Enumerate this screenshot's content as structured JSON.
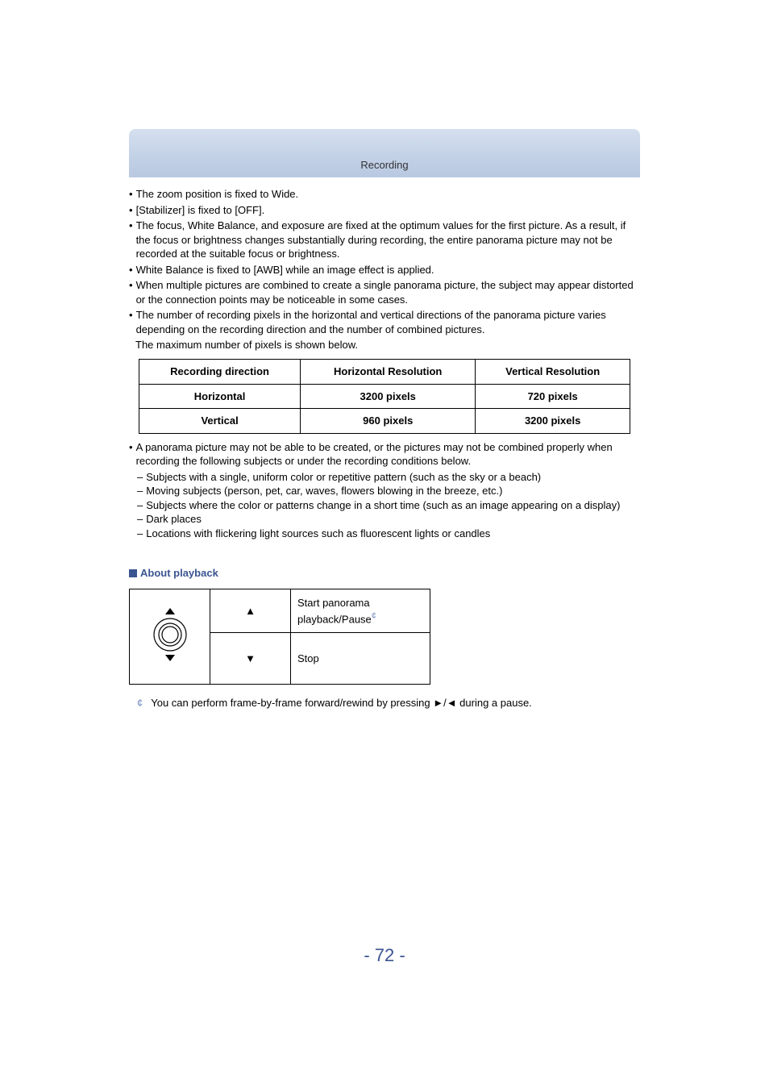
{
  "header": {
    "title": "Recording"
  },
  "bullets": [
    "The zoom position is fixed to Wide.",
    "[Stabilizer] is fixed to [OFF].",
    "The focus, White Balance, and exposure are fixed at the optimum values for the first picture. As a result, if the focus or brightness changes substantially during recording, the entire panorama picture may not be recorded at the suitable focus or brightness.",
    "White Balance is fixed to [AWB] while an image effect is applied.",
    "When multiple pictures are combined to create a single panorama picture, the subject may appear distorted or the connection points may be noticeable in some cases."
  ],
  "pixels_intro": "The number of recording pixels in the horizontal and vertical directions of the panorama picture varies depending on the recording direction and the number of combined pictures.",
  "pixels_intro2": "The maximum number of pixels is shown below.",
  "resolution_table": {
    "headers": [
      "Recording direction",
      "Horizontal Resolution",
      "Vertical Resolution"
    ],
    "rows": [
      [
        "Horizontal",
        "3200 pixels",
        "720 pixels"
      ],
      [
        "Vertical",
        "960 pixels",
        "3200 pixels"
      ]
    ]
  },
  "panorama_bullet": "A panorama picture may not be able to be created, or the pictures may not be combined properly when recording the following subjects or under the recording conditions below.",
  "dashes": [
    "Subjects with a single, uniform color or repetitive pattern (such as the sky or a beach)",
    "Moving subjects (person, pet, car, waves, flowers blowing in the breeze, etc.)",
    "Subjects where the color or patterns change in a short time (such as an image appearing on a display)",
    "Dark places",
    "Locations with flickering light sources such as fluorescent lights or candles"
  ],
  "playback": {
    "heading": "About playback",
    "rows": [
      {
        "arrow": "▲",
        "desc": "Start panorama playback/Pause",
        "sup": "¢"
      },
      {
        "arrow": "▼",
        "desc": "Stop",
        "sup": ""
      }
    ]
  },
  "footnote": {
    "mark": "¢",
    "text_pre": "You can perform frame-by-frame forward/rewind by pressing ",
    "right": "►",
    "slash": "/",
    "left": "◄",
    "text_post": " during a pause."
  },
  "page_number": "- 72 -"
}
